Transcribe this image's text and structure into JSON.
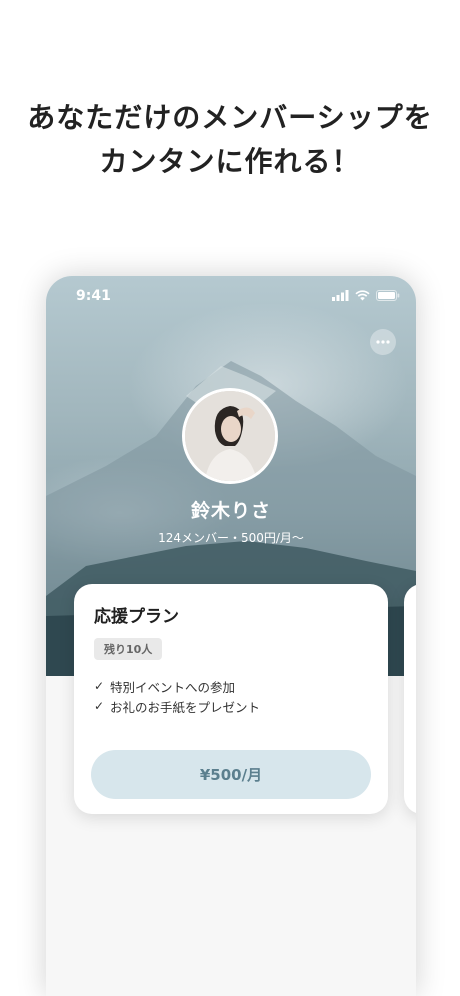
{
  "promo": {
    "line1": "あなただけのメンバーシップを",
    "line2": "カンタンに作れる！"
  },
  "status_bar": {
    "time": "9:41",
    "icons": [
      "signal-icon",
      "wifi-icon",
      "battery-icon"
    ]
  },
  "profile": {
    "name": "鈴木りさ",
    "subtitle": "124メンバー・500円/月〜",
    "menu_icon": "more-horizontal-icon"
  },
  "plan": {
    "title": "応援プラン",
    "remaining": "残り10人",
    "benefits": [
      "特別イベントへの参加",
      "お礼のお手紙をプレゼント"
    ],
    "check_icon": "check-icon",
    "price_label": "¥500/月"
  },
  "colors": {
    "accent_bg": "#d7e6ec",
    "accent_text": "#5b7f8e",
    "hero_sky": "#a1b6bd"
  }
}
